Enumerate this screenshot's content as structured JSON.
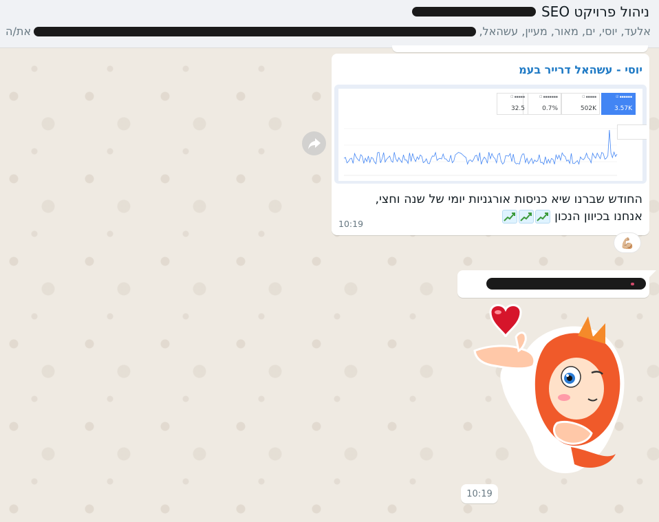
{
  "header": {
    "group_name": "ניהול פרויקט SEO",
    "group_name_prefix": "",
    "members_visible": "אלעד, יוסי, ים, מאור, מעיין, עשהאל,",
    "members_suffix": "את/ה"
  },
  "message": {
    "sender": "יוסי - עשהאל דרייר בעמ",
    "text_line1": "החודש שברנו שיא כניסות אורגניות יומי של שנה וחצי,",
    "text_line2": "אנחנו בכיוון הנכון",
    "emoji_names": [
      "chart-increasing-icon",
      "chart-increasing-icon",
      "chart-increasing-icon"
    ],
    "time": "10:19",
    "reaction_emoji": "💪🏼"
  },
  "screenshot_image": {
    "metrics": [
      {
        "value": "3.57K",
        "active": true
      },
      {
        "value": "502K",
        "active": false
      },
      {
        "value": "0.7%",
        "active": false
      },
      {
        "value": "32.5",
        "active": false
      }
    ]
  },
  "second_message": {
    "sticker_name": "monkey-heart-sticker",
    "time": "10:19"
  },
  "colors": {
    "wallpaper": "#efeae2",
    "header_bg": "#f0f2f5",
    "sender_name": "#1f7ac5",
    "chart_line": "#4285f4",
    "metric_active": "#4285f4"
  }
}
